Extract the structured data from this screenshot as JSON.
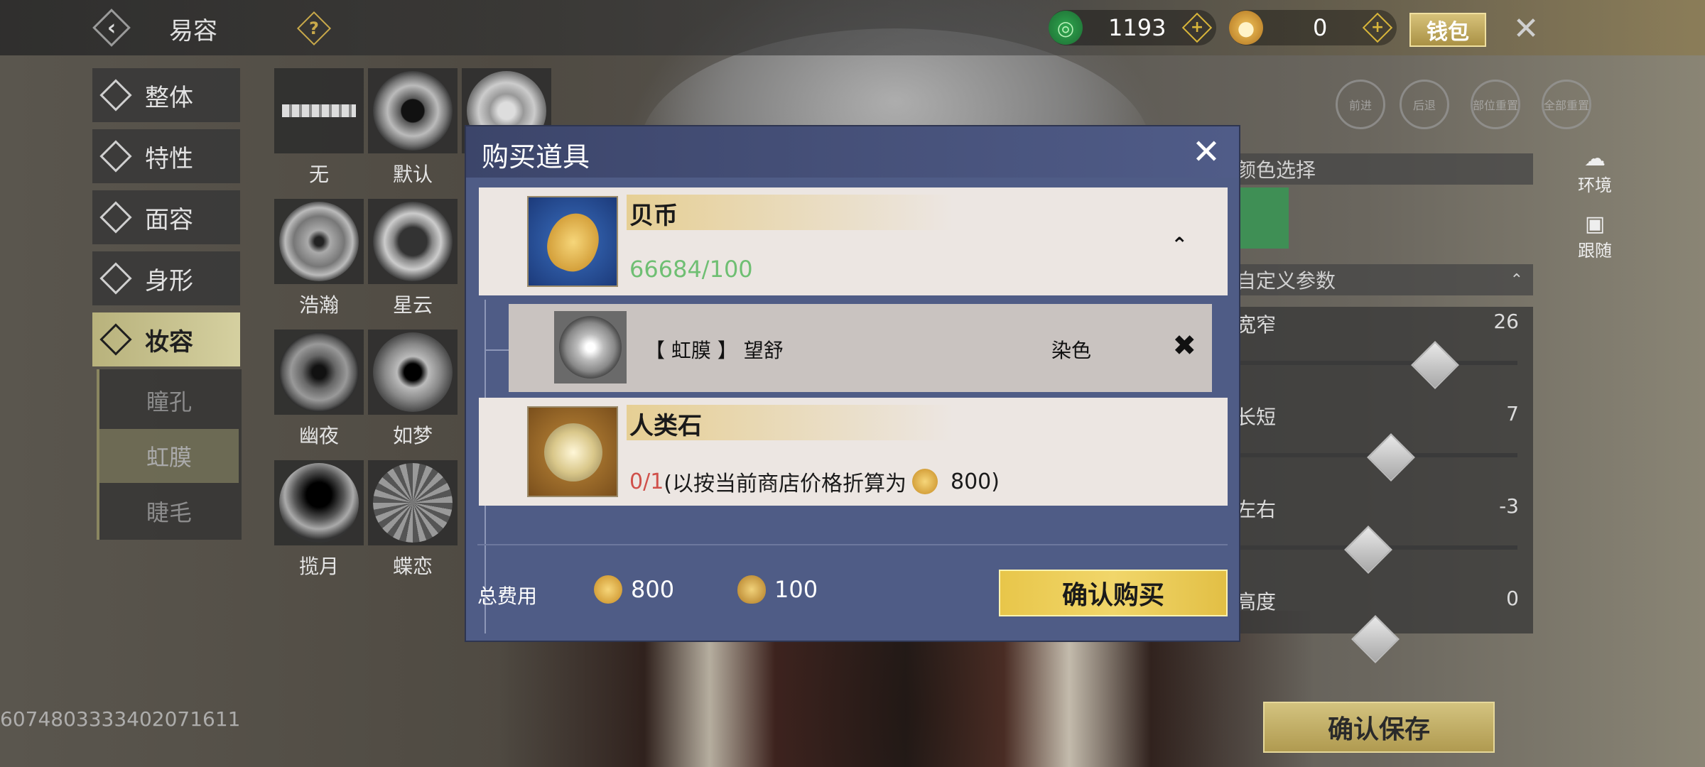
{
  "topbar": {
    "title": "易容",
    "help_icon": "question-icon",
    "currency_jade": "1193",
    "currency_shell": "0",
    "wallet_label": "钱包"
  },
  "nav": {
    "items": [
      {
        "label": "整体"
      },
      {
        "label": "特性"
      },
      {
        "label": "面容"
      },
      {
        "label": "身形"
      },
      {
        "label": "妆容"
      }
    ],
    "active": "妆容",
    "sub_items": [
      {
        "label": "瞳孔"
      },
      {
        "label": "虹膜"
      },
      {
        "label": "睫毛"
      }
    ],
    "active_sub": "虹膜"
  },
  "eyes": [
    {
      "label": "无"
    },
    {
      "label": "默认"
    },
    {
      "label": "浩瀚"
    },
    {
      "label": "星云"
    },
    {
      "label": "幽夜"
    },
    {
      "label": "如梦"
    },
    {
      "label": "揽月"
    },
    {
      "label": "蝶恋"
    }
  ],
  "right_panel": {
    "history": [
      "前进",
      "后退",
      "部位重置",
      "全部重置"
    ],
    "side_env": "环境",
    "side_follow": "跟随",
    "color_header": "颜色选择",
    "param_header": "自定义参数",
    "params": [
      {
        "label": "宽窄",
        "value": "26",
        "level": 0.62
      },
      {
        "label": "长短",
        "value": "7",
        "level": 0.53
      },
      {
        "label": "左右",
        "value": "-3",
        "level": 0.45
      },
      {
        "label": "高度",
        "value": "0",
        "level": 0.5
      }
    ],
    "color_value": "#3f8f55",
    "save_label": "确认保存"
  },
  "uid": "6074803333402071611",
  "modal": {
    "title": "购买道具",
    "items": [
      {
        "name": "贝币",
        "qty": "66684/100",
        "qty_color": "#6fbf73"
      },
      {
        "name": "人类石",
        "qty_prefix": "0/1",
        "qty_suffix": "(以按当前商店价格折算为",
        "qty_price": "800)"
      }
    ],
    "sub_item": {
      "name": "【 虹膜 】  望舒",
      "tag": "染色"
    },
    "total_label": "总费用",
    "cost_gold": "800",
    "cost_shell": "100",
    "confirm_label": "确认购买"
  }
}
